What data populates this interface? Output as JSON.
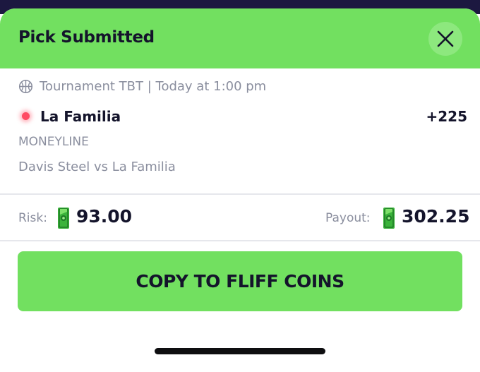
{
  "header": {
    "title": "Pick Submitted",
    "close_icon": "close-icon"
  },
  "pick": {
    "sport_icon": "basketball-icon",
    "event": "Tournament TBT | Today at 1:00 pm",
    "selection": "La Familia",
    "odds": "+225",
    "market": "MONEYLINE",
    "matchup": "Davis Steel vs La Familia",
    "status_color": "#ff4b63"
  },
  "wager": {
    "risk_label": "Risk:",
    "risk_amount": "93.00",
    "payout_label": "Payout:",
    "payout_amount": "302.25",
    "currency_icon": "cash-icon"
  },
  "actions": {
    "copy_label": "COPY TO FLIFF COINS"
  },
  "colors": {
    "accent": "#72e060",
    "text": "#14142b",
    "muted": "#8a8e9e"
  }
}
